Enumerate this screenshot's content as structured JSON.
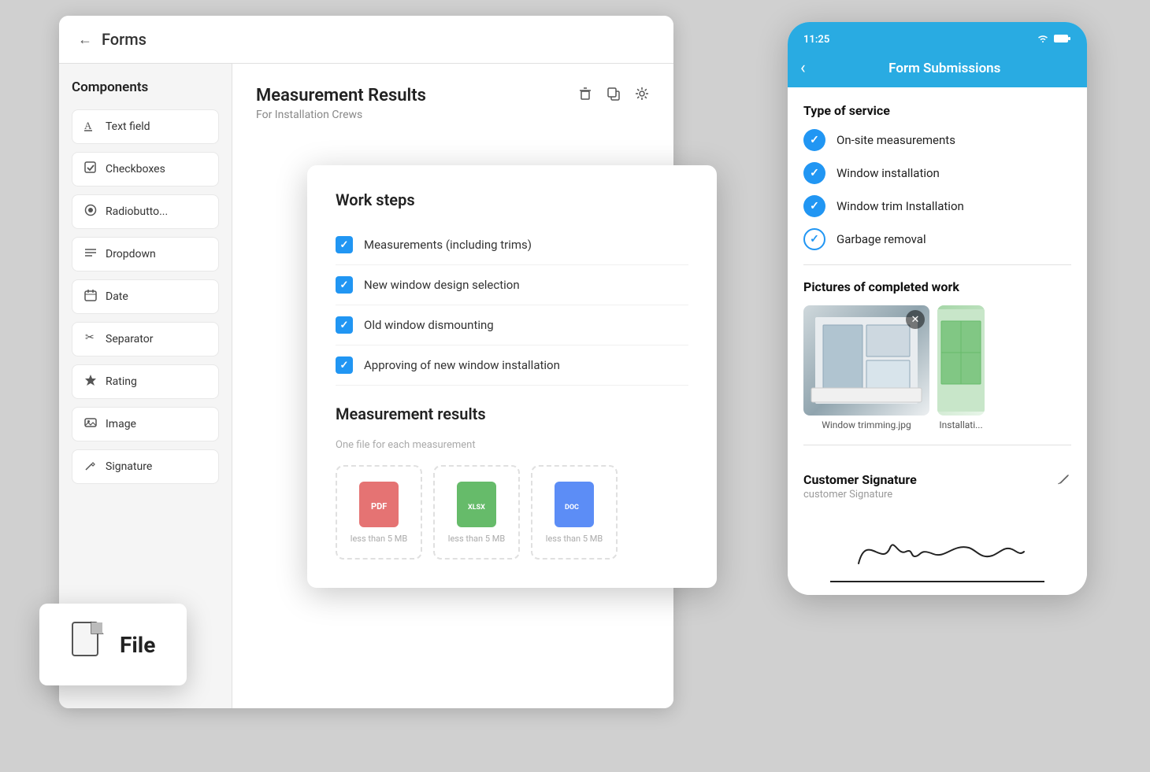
{
  "forms_panel": {
    "back_label": "←",
    "title": "Forms",
    "components_title": "Components",
    "components": [
      {
        "id": "text-field",
        "icon": "T",
        "label": "Text field"
      },
      {
        "id": "checkboxes",
        "icon": "☑",
        "label": "Checkboxes"
      },
      {
        "id": "radiobutton",
        "icon": "◉",
        "label": "Radiobutto..."
      },
      {
        "id": "dropdown",
        "icon": "≡",
        "label": "Dropdown"
      },
      {
        "id": "date",
        "icon": "📅",
        "label": "Date"
      },
      {
        "id": "separator",
        "icon": "✂",
        "label": "Separator"
      },
      {
        "id": "rating",
        "icon": "★",
        "label": "Rating"
      },
      {
        "id": "image",
        "icon": "🖼",
        "label": "Image"
      },
      {
        "id": "signature",
        "icon": "✏",
        "label": "Signature"
      }
    ],
    "file_tooltip": {
      "label": "File"
    },
    "form_name": "Measurement Results",
    "form_subtitle": "For Installation Crews"
  },
  "work_steps_modal": {
    "title": "Work steps",
    "items": [
      "Measurements (including trims)",
      "New window design selection",
      "Old window dismounting",
      "Approving of new window installation"
    ],
    "measurement_title": "Measurement results",
    "measurement_hint": "One file for each measurement",
    "file_types": [
      {
        "type": "pdf",
        "size": "less than 5 MB"
      },
      {
        "type": "xlsx",
        "size": "less than 5 MB"
      },
      {
        "type": "docx",
        "size": "less than 5 MB"
      }
    ]
  },
  "mobile_panel": {
    "status_time": "11:25",
    "header_title": "Form Submissions",
    "back_icon": "‹",
    "type_of_service_label": "Type of service",
    "services": [
      {
        "text": "On-site measurements",
        "checked": true,
        "outline": false
      },
      {
        "text": "Window installation",
        "checked": true,
        "outline": false
      },
      {
        "text": "Window trim Installation",
        "checked": true,
        "outline": false
      },
      {
        "text": "Garbage removal",
        "checked": true,
        "outline": true
      }
    ],
    "pictures_label": "Pictures of completed work",
    "pictures": [
      {
        "caption": "Window trimming.jpg"
      },
      {
        "caption": "Installati..."
      }
    ],
    "signature_title": "Customer Signature",
    "signature_hint": "customer Signature"
  }
}
